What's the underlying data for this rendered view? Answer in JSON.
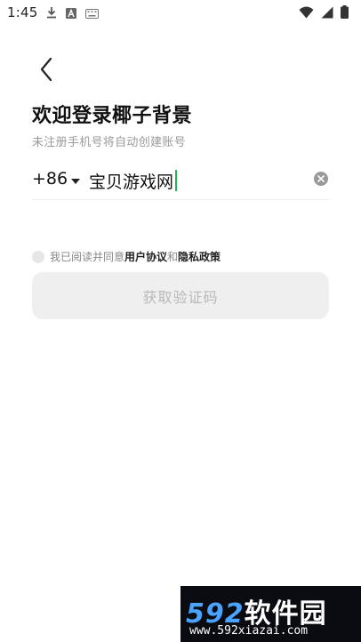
{
  "status_bar": {
    "time": "1:45",
    "icons_left": [
      "download-icon",
      "font-a-icon",
      "keyboard-icon"
    ],
    "icons_right": [
      "wifi-icon",
      "signal-icon",
      "battery-icon"
    ]
  },
  "header": {
    "back_icon": "chevron-left-icon"
  },
  "login": {
    "title": "欢迎登录椰子背景",
    "subtitle": "未注册手机号将自动创建账号",
    "country_code": "+86",
    "phone_value": "宝贝游戏网",
    "clear_icon": "clear-circle-icon",
    "agreement_prefix": "我已阅读并同意",
    "agreement_user": "用户协议",
    "agreement_and": "和",
    "agreement_privacy": "隐私政策",
    "get_code_label": "获取验证码"
  },
  "watermark": {
    "logo_num": "592",
    "logo_cn": "软件园",
    "url": "www.592xiazai.com"
  },
  "colors": {
    "caret": "#1db954",
    "button_bg": "#efefef",
    "button_text": "#b8b8b8",
    "subtitle": "#9a9a9a"
  }
}
